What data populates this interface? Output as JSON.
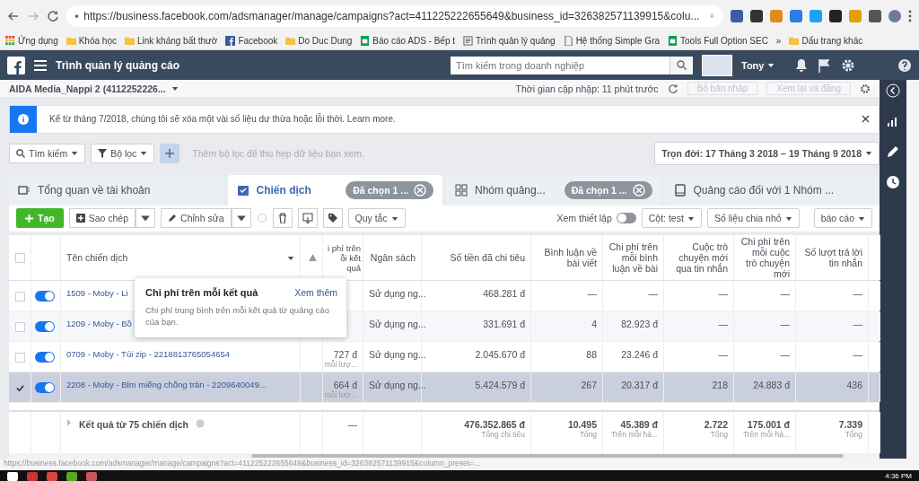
{
  "browser": {
    "url": "https://business.facebook.com/adsmanager/manage/campaigns?act=411225222655649&business_id=326382571139915&colu..."
  },
  "bookmarks": [
    {
      "kind": "apps",
      "label": "Ứng dụng"
    },
    {
      "kind": "folder",
      "label": "Khóa học"
    },
    {
      "kind": "folder",
      "label": "Link kháng bất thườ"
    },
    {
      "kind": "fb",
      "label": "Facebook"
    },
    {
      "kind": "folder",
      "label": "Do Duc Dung"
    },
    {
      "kind": "sheet",
      "label": "Báo cáo ADS - Bếp t"
    },
    {
      "kind": "doc",
      "label": "Trình quản lý quảng"
    },
    {
      "kind": "page",
      "label": "Hệ thống Simple Gra"
    },
    {
      "kind": "sheet",
      "label": "Tools Full Option SEC"
    },
    {
      "kind": "more",
      "label": "»"
    },
    {
      "kind": "folder",
      "label": "Dấu trang khác"
    }
  ],
  "header": {
    "title": "Trình quản lý quảng cáo",
    "search_placeholder": "Tìm kiếm trong doanh nghiệp",
    "user": "Tony"
  },
  "account_bar": {
    "account": "AIDA Media_Nappi 2 (4112252226...",
    "updated": "Thời gian cập nhập: 11 phút trước",
    "buttons": [
      "Bỏ bản nháp",
      "Xem lại và đăng"
    ]
  },
  "notice": {
    "text": "Kể từ tháng 7/2018, chúng tôi sẽ xóa một vài số liệu dư thừa hoặc lỗi thời. Learn more."
  },
  "filter_bar": {
    "search": "Tìm kiếm",
    "filter": "Bộ lọc",
    "placeholder": "Thêm bộ lọc để thu hẹp dữ liệu bạn xem.",
    "date_range": "Trọn đời: 17 Tháng 3 2018 – 19 Tháng 9 2018"
  },
  "tabs": [
    {
      "label": "Tổng quan về tài khoản",
      "kind": "overview",
      "selected": false
    },
    {
      "label": "Chiến dịch",
      "kind": "campaign",
      "selected": true,
      "chip": "Đã chọn 1 ..."
    },
    {
      "label": "Nhóm quảng...",
      "kind": "adset",
      "selected": false,
      "chip": "Đã chọn 1 ..."
    },
    {
      "label": "Quảng cáo đối với 1 Nhóm ...",
      "kind": "ad",
      "selected": false
    }
  ],
  "toolbar": {
    "create": "Tạo",
    "duplicate": "Sao chép",
    "edit": "Chỉnh sửa",
    "rules": "Quy tắc",
    "view_setup": "Xem thiết lập",
    "view_setup_on": false,
    "columns": "Cột: test",
    "breakdown": "Số liệu chia nhỏ",
    "reports": "báo cáo"
  },
  "table": {
    "select_all_checked": false,
    "columns": [
      "Tên chiến dịch",
      "i phí trên ỗi kết quả",
      "Ngân sách",
      "Số tiền đã chi tiêu",
      "Bình luận về bài viết",
      "Chi phí trên mỗi bình luận về bài",
      "Cuộc trò chuyện mới qua tin nhắn",
      "Chi phí trên mỗi cuộc trò chuyện mới",
      "Số lượt trả lời tin nhắn"
    ],
    "rows": [
      {
        "checked": false,
        "on": true,
        "selected": false,
        "cells": [
          "1509 - Moby - Li",
          "",
          "Sử dụng ng...",
          "468.281 đ",
          "—",
          "—",
          "—",
          "—",
          "—"
        ]
      },
      {
        "checked": false,
        "on": true,
        "selected": false,
        "cells": [
          "1209 - Moby - Bồ",
          "",
          "Sử dụng ng...",
          "331.691 đ",
          "4",
          "82.923 đ",
          "—",
          "—",
          "—"
        ]
      },
      {
        "checked": false,
        "on": true,
        "selected": false,
        "cells": [
          "0709 - Moby - Túi zip - 2218813765054654",
          {
            "value": "727 đ",
            "note": "mỗi lượ..."
          },
          "Sử dụng ng...",
          "2.045.670 đ",
          "88",
          "23.246 đ",
          "—",
          "—",
          "—"
        ]
      },
      {
        "checked": true,
        "on": true,
        "selected": true,
        "cells": [
          "2208 - Moby - Bỉm miếng chống tràn - 2209640049...",
          {
            "value": "664 đ",
            "note": "mỗi lượ..."
          },
          "Sử dụng ng...",
          "5.424.579 đ",
          "267",
          "20.317 đ",
          "218",
          "24.883 đ",
          "436"
        ]
      }
    ],
    "footer": {
      "cells": [
        "Kết quả từ 75 chiến dịch",
        "—",
        "",
        {
          "value": "476.352.865 đ",
          "note": "Tổng chi tiêu"
        },
        {
          "value": "10.495",
          "note": "Tổng"
        },
        {
          "value": "45.389 đ",
          "note": "Trên mỗi hà..."
        },
        {
          "value": "2.722",
          "note": "Tổng"
        },
        {
          "value": "175.001 đ",
          "note": "Trên mỗi hà..."
        },
        {
          "value": "7.339",
          "note": "Tổng"
        }
      ]
    }
  },
  "tooltip": {
    "title": "Chi phí trên mỗi kết quả",
    "link": "Xem thêm",
    "text": "Chi phí trung bình trên mỗi kết quả từ quảng cáo của bạn."
  },
  "status_url": "https://business.facebook.com/adsmanager/manage/campaigns?act=411225222655649&business_id=326382571139915&column_preset=...",
  "taskbar": {
    "time": "4:36 PM"
  }
}
